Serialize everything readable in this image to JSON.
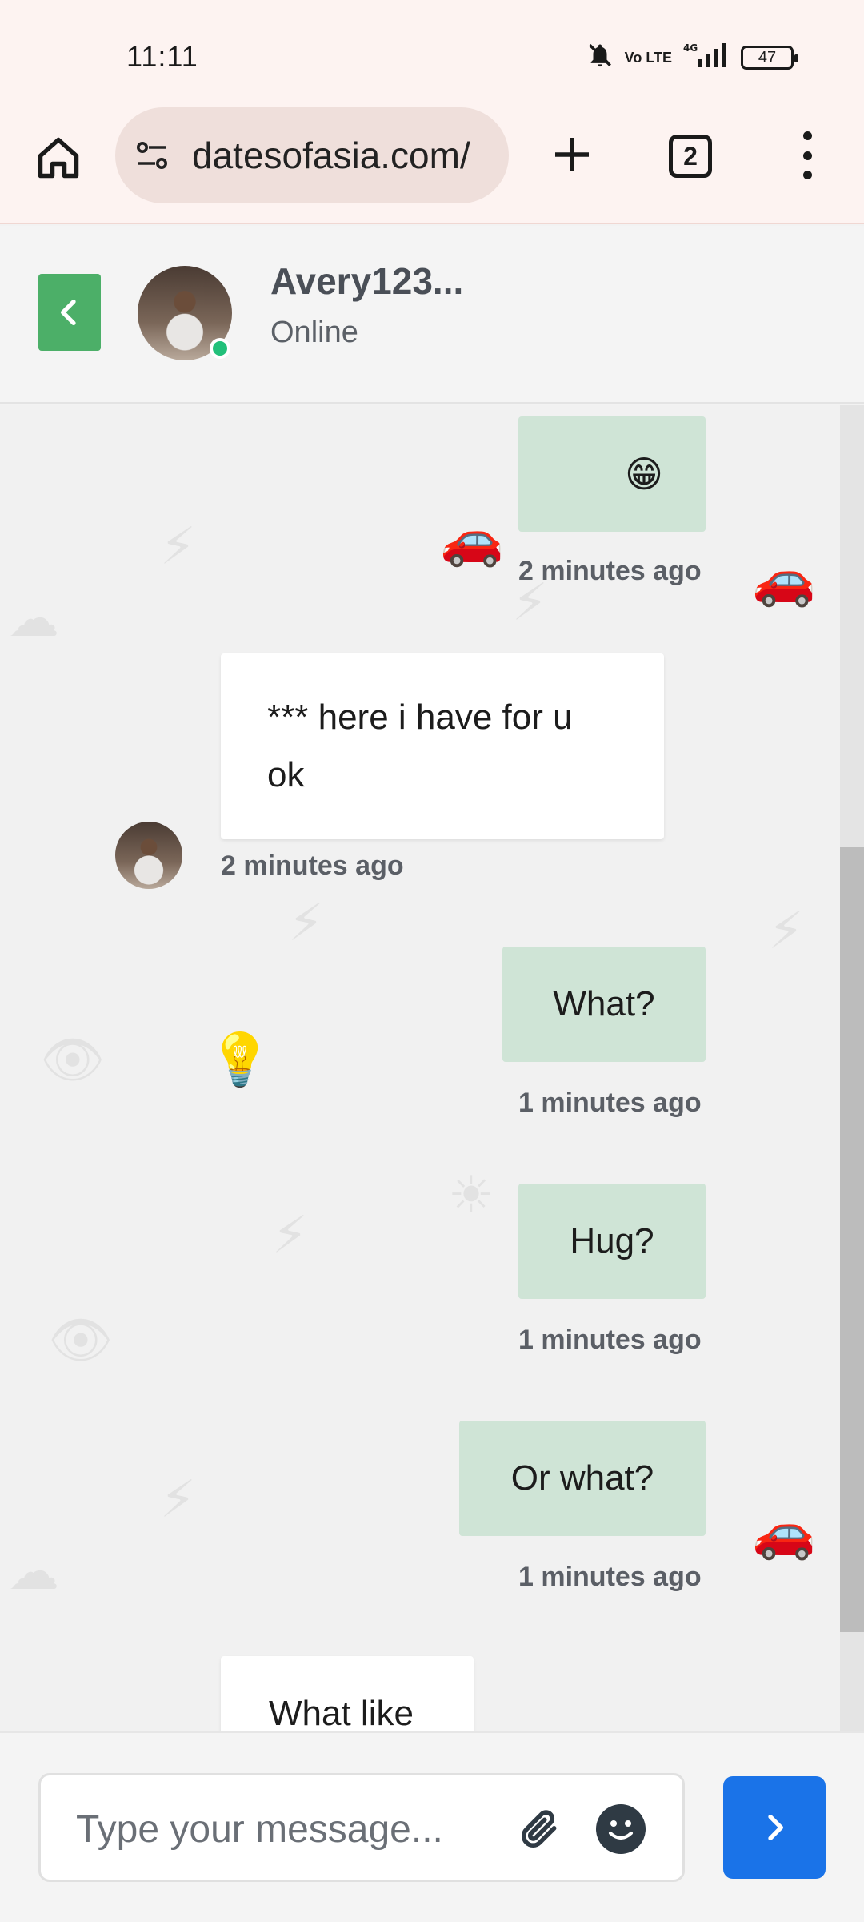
{
  "status_bar": {
    "time": "11:11",
    "network_label": "4G",
    "volte_label": "Vo LTE",
    "battery_level": "47"
  },
  "browser": {
    "url": "datesofasia.com/",
    "tab_count": "2"
  },
  "chat_header": {
    "contact_name": "Avery123...",
    "contact_status": "Online"
  },
  "messages": [
    {
      "direction": "sent",
      "text": "😁",
      "timestamp": "2 minutes ago"
    },
    {
      "direction": "received",
      "text": "*** here i have for u ok",
      "timestamp": "2 minutes ago"
    },
    {
      "direction": "sent",
      "text": "What?",
      "timestamp": "1 minutes ago"
    },
    {
      "direction": "sent",
      "text": "Hug?",
      "timestamp": "1 minutes ago"
    },
    {
      "direction": "sent",
      "text": "Or what?",
      "timestamp": "1 minutes ago"
    },
    {
      "direction": "received",
      "text": "What like"
    }
  ],
  "composer": {
    "placeholder": "Type your message..."
  },
  "colors": {
    "accent_green": "#4caf68",
    "sent_bubble": "#cfe4d6",
    "send_button": "#1a73e8",
    "online": "#22c07a"
  }
}
